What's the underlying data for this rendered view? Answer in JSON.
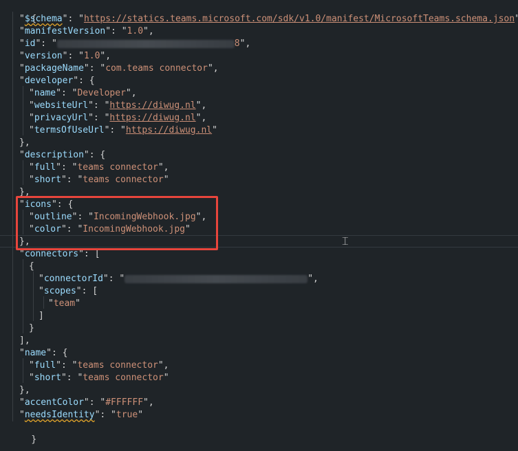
{
  "editor": {
    "manifest": {
      "open_brace": "{",
      "schema_key": "$schema",
      "schema_value": "https://statics.teams.microsoft.com/sdk/v1.0/manifest/MicrosoftTeams.schema.json",
      "manifestVersion_key": "manifestVersion",
      "manifestVersion_value": "1.0",
      "id_key": "id",
      "id_value_visible_tail": "8",
      "version_key": "version",
      "version_value": "1.0",
      "packageName_key": "packageName",
      "packageName_value": "com.teams connector",
      "developer_key": "developer",
      "developer_name_key": "name",
      "developer_name_value": "Developer",
      "websiteUrl_key": "websiteUrl",
      "websiteUrl_value": "https://diwug.nl",
      "privacyUrl_key": "privacyUrl",
      "privacyUrl_value": "https://diwug.nl",
      "termsOfUseUrl_key": "termsOfUseUrl",
      "termsOfUseUrl_value": "https://diwug.nl",
      "description_key": "description",
      "description_full_key": "full",
      "description_full_value": "teams connector",
      "description_short_key": "short",
      "description_short_value": "teams connector",
      "icons_key": "icons",
      "icons_outline_key": "outline",
      "icons_outline_value": "IncomingWebhook.jpg",
      "icons_color_key": "color",
      "icons_color_value": "IncomingWebhook.jpg",
      "connectors_key": "connectors",
      "connectorId_key": "connectorId",
      "scopes_key": "scopes",
      "scope_value": "team",
      "name_key": "name",
      "name_full_key": "full",
      "name_full_value": "teams connector",
      "name_short_key": "short",
      "name_short_value": "teams connector",
      "accentColor_key": "accentColor",
      "accentColor_value": "#FFFFFF",
      "needsIdentity_key": "needsIdentity",
      "needsIdentity_value": "true",
      "close_brace": "}"
    }
  },
  "annotations": {
    "highlight_color": "#e8453c"
  },
  "colors": {
    "background": "#1f2428",
    "key": "#9cdcfe",
    "string": "#ce9178",
    "punctuation": "#d4d4d4",
    "squiggle": "#e2a52a"
  },
  "icons": {
    "text_cursor": "i-beam-cursor-icon"
  }
}
